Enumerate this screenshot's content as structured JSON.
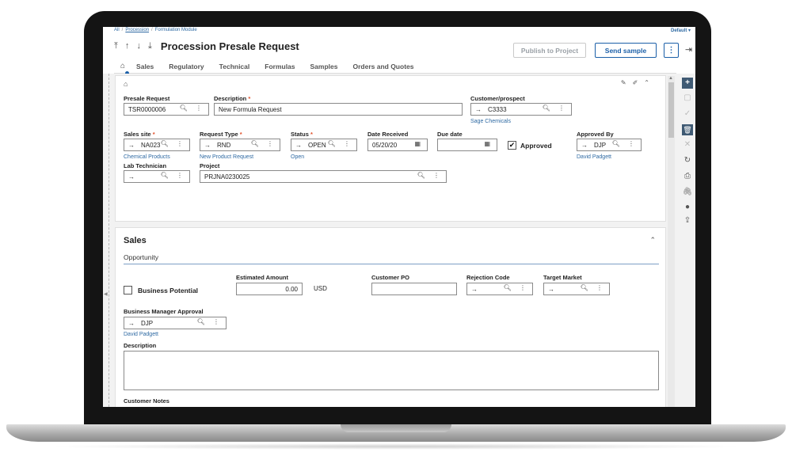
{
  "breadcrumb": {
    "root": "All",
    "level1": "Procession",
    "level2": "Formulation Module"
  },
  "header": {
    "default_label": "Default ▾",
    "nav_arrows": "⤒ ↑ ↓ ⤓",
    "title": "Procession Presale Request",
    "publish_label": "Publish to Project",
    "send_label": "Send sample",
    "kebab": "⋮",
    "exit_icon": "exit-icon"
  },
  "tabs": [
    "Sales",
    "Regulatory",
    "Technical",
    "Formulas",
    "Samples",
    "Orders and Quotes"
  ],
  "form": {
    "presale_request": {
      "label": "Presale Request",
      "value": "TSR0000006"
    },
    "description": {
      "label": "Description",
      "value": "New Formula Request"
    },
    "customer": {
      "label": "Customer/prospect",
      "value": "C3333",
      "link": "Sage Chemicals"
    },
    "sales_site": {
      "label": "Sales site",
      "value": "NA023",
      "link": "Chemical Products"
    },
    "request_type": {
      "label": "Request Type",
      "value": "RND",
      "link": "New Product Request"
    },
    "status": {
      "label": "Status",
      "value": "OPEN",
      "link": "Open"
    },
    "date_received": {
      "label": "Date Received",
      "value": "05/20/20"
    },
    "due_date": {
      "label": "Due date",
      "value": ""
    },
    "approved": {
      "label": "Approved",
      "checked": true
    },
    "approved_by": {
      "label": "Approved By",
      "value": "DJP",
      "link": "David Padgett"
    },
    "lab_technician": {
      "label": "Lab Technician",
      "value": ""
    },
    "project": {
      "label": "Project",
      "value": "PRJNA0230025"
    }
  },
  "sales": {
    "title": "Sales",
    "subtitle": "Opportunity",
    "business_potential": {
      "label": "Business Potential",
      "checked": false
    },
    "estimated_amount": {
      "label": "Estimated Amount",
      "value": "0.00",
      "currency": "USD"
    },
    "customer_po": {
      "label": "Customer PO",
      "value": ""
    },
    "rejection_code": {
      "label": "Rejection Code",
      "value": ""
    },
    "target_market": {
      "label": "Target Market",
      "value": ""
    },
    "bm_approval": {
      "label": "Business Manager Approval",
      "value": "DJP",
      "link": "David Padgett"
    },
    "description_label": "Description",
    "customer_notes_label": "Customer Notes"
  },
  "colors": {
    "accent": "#1b5fa8",
    "link": "#2f6aa3",
    "required": "#e0502a"
  }
}
